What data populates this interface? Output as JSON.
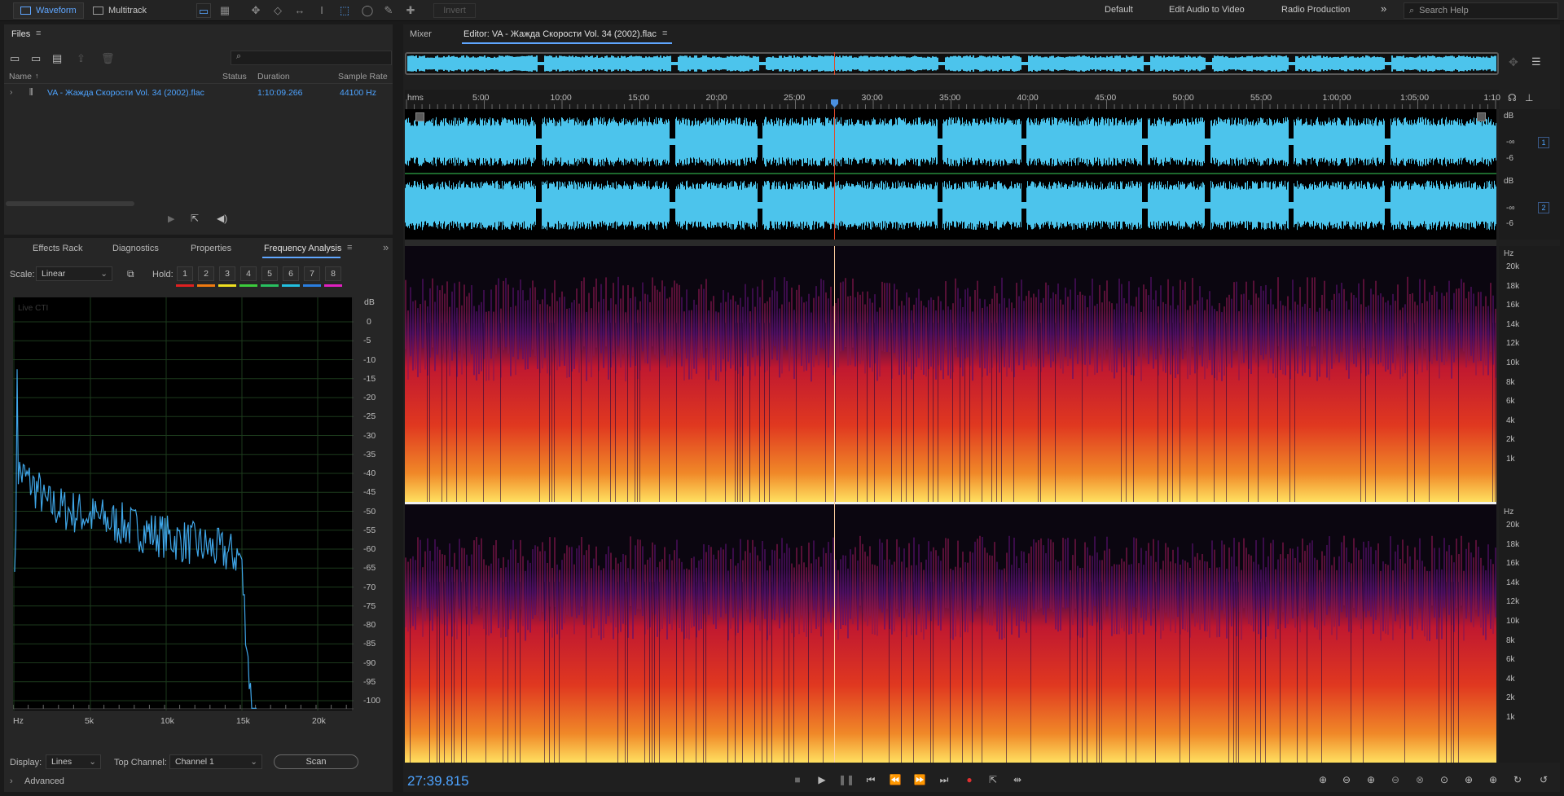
{
  "topbar": {
    "modes": [
      {
        "label": "Waveform",
        "active": true
      },
      {
        "label": "Multitrack",
        "active": false
      }
    ],
    "invert_label": "Invert",
    "workspaces": [
      "Default",
      "Edit Audio to Video",
      "Radio Production"
    ],
    "overflow": "»",
    "search_placeholder": "Search Help"
  },
  "files_panel": {
    "title": "Files",
    "columns": [
      "Name",
      "Status",
      "Duration",
      "Sample Rate"
    ],
    "row": {
      "name": "VA - Жажда Скорости Vol. 34 (2002).flac",
      "duration": "1:10:09.266",
      "sample_rate": "44100 Hz"
    }
  },
  "tool_tabs": {
    "tabs": [
      "Effects Rack",
      "Diagnostics",
      "Properties",
      "Frequency Analysis"
    ],
    "selected": "Frequency Analysis",
    "overflow": "»"
  },
  "freq": {
    "scale_label": "Scale:",
    "scale_value": "Linear",
    "hold_label": "Hold:",
    "holds": [
      "1",
      "2",
      "3",
      "4",
      "5",
      "6",
      "7",
      "8"
    ],
    "hold_colors": [
      "#e02020",
      "#f07a10",
      "#f0e020",
      "#3ccc3c",
      "#28c060",
      "#22c0e0",
      "#2a7ee0",
      "#e020c0"
    ],
    "live_label": "Live CTI",
    "db_unit": "dB",
    "db_labels": [
      "0",
      "-5",
      "-10",
      "-15",
      "-20",
      "-25",
      "-30",
      "-35",
      "-40",
      "-45",
      "-50",
      "-55",
      "-60",
      "-65",
      "-70",
      "-75",
      "-80",
      "-85",
      "-90",
      "-95",
      "-100"
    ],
    "hz_labels": [
      "Hz",
      "5k",
      "10k",
      "15k",
      "20k"
    ],
    "display_label": "Display:",
    "display_value": "Lines",
    "top_channel_label": "Top Channel:",
    "top_channel_value": "Channel 1",
    "scan_label": "Scan",
    "advanced_label": "Advanced",
    "line_color": "#3fa6e8"
  },
  "editor": {
    "mixer_tab": "Mixer",
    "editor_tab": "Editor: VA - Жажда Скорости Vol. 34 (2002).flac",
    "time_unit": "hms",
    "time_labels": [
      "5:00",
      "10:00",
      "15:00",
      "20:00",
      "25:00",
      "30:00",
      "35:00",
      "40:00",
      "45:00",
      "50:00",
      "55:00",
      "1:00:00",
      "1:05:00",
      "1:10"
    ],
    "db_unit": "dB",
    "db_marks": [
      "-∞",
      "-6"
    ],
    "channels": [
      "1",
      "2"
    ],
    "hz_unit": "Hz",
    "spectral_labels": [
      "20k",
      "18k",
      "16k",
      "14k",
      "12k",
      "10k",
      "8k",
      "6k",
      "4k",
      "2k",
      "1k"
    ],
    "current_time": "27:39.815",
    "wave_color": "#4cc4ec"
  }
}
